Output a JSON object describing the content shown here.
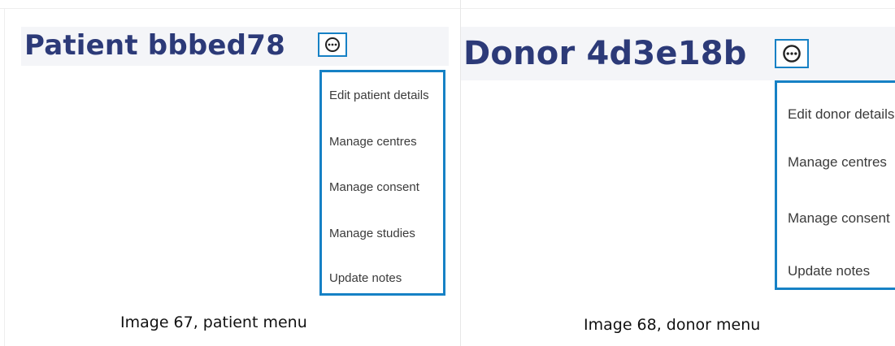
{
  "patient": {
    "title": "Patient bbbed78",
    "menu": [
      {
        "label": "Edit patient details"
      },
      {
        "label": "Manage centres"
      },
      {
        "label": "Manage consent"
      },
      {
        "label": "Manage studies"
      },
      {
        "label": "Update notes"
      }
    ],
    "caption": "Image 67, patient menu"
  },
  "donor": {
    "title": "Donor 4d3e18b",
    "menu": [
      {
        "label": "Edit donor details"
      },
      {
        "label": "Manage centres"
      },
      {
        "label": "Manage consent"
      },
      {
        "label": "Update notes"
      }
    ],
    "caption": "Image 68, donor menu"
  },
  "colors": {
    "title": "#2c3a78",
    "accent": "#1681c5",
    "header_band": "#f4f5f8",
    "menu_text": "#3b3b3b"
  },
  "icons": {
    "menu_toggle": "more-options-circle-icon"
  }
}
